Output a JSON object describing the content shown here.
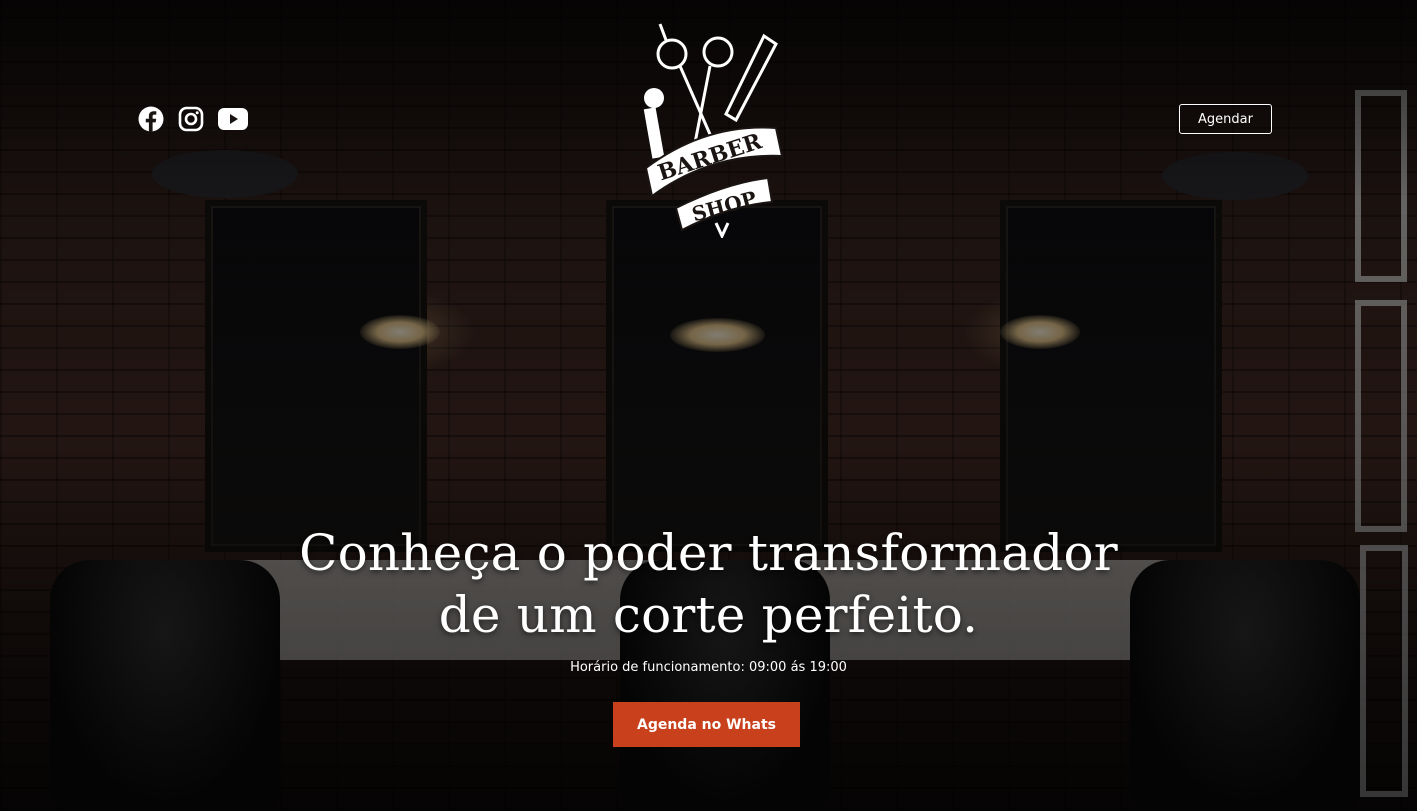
{
  "header": {
    "social_icons": [
      "facebook-icon",
      "instagram-icon",
      "youtube-icon"
    ],
    "logo": {
      "line1": "BARBER",
      "line2": "SHOP"
    },
    "cta_label": "Agendar"
  },
  "hero": {
    "headline_line1": "Conheça o poder transformador",
    "headline_line2": "de um corte perfeito.",
    "hours": "Horário de funcionamento: 09:00 ás 19:00",
    "button_label": "Agenda no Whats"
  },
  "colors": {
    "accent": "#c8401c",
    "text": "#ffffff"
  }
}
